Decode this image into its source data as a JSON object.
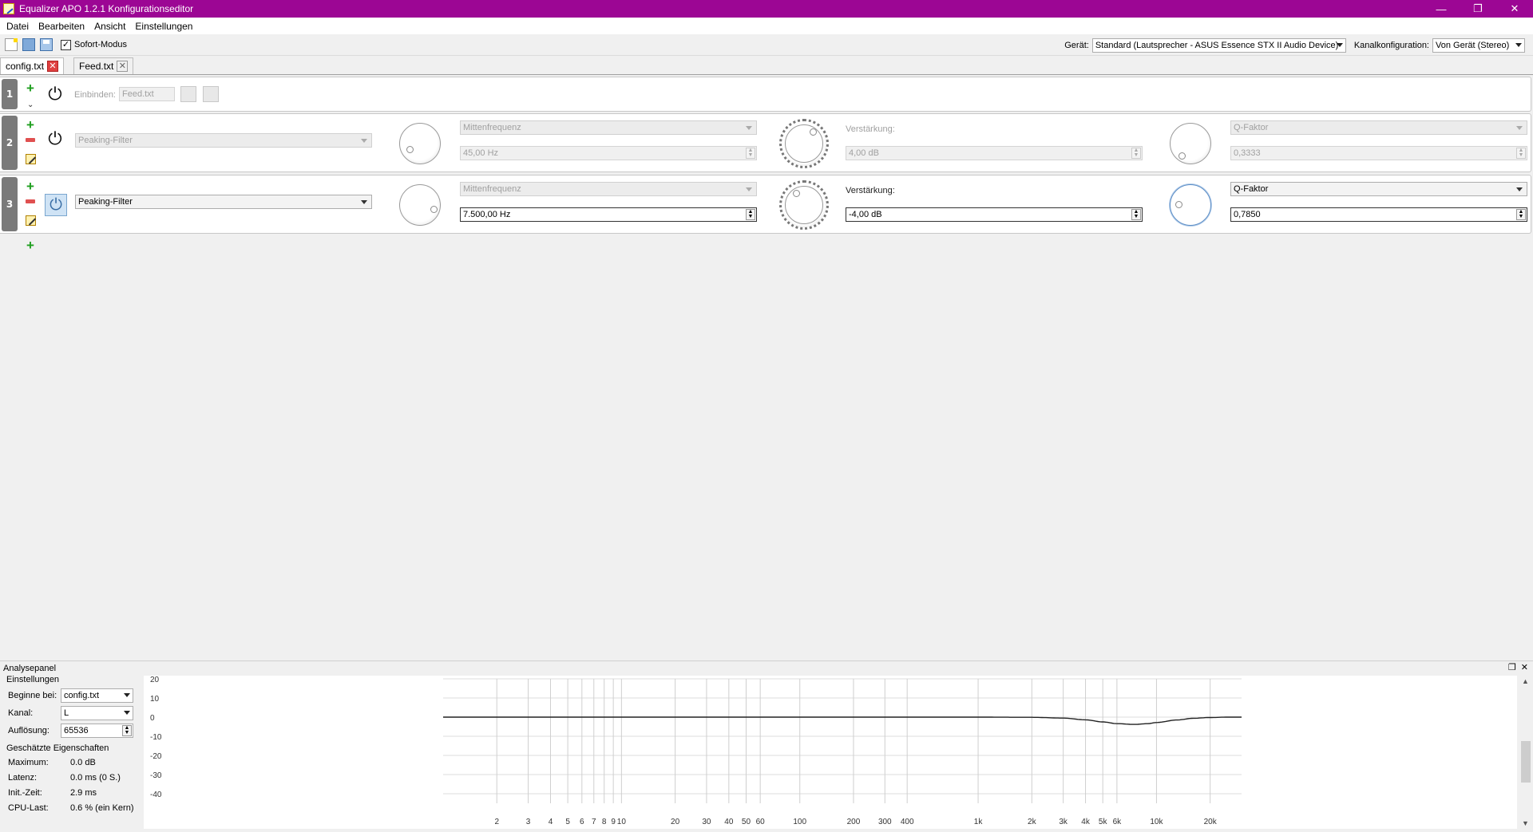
{
  "window": {
    "title": "Equalizer APO 1.2.1 Konfigurationseditor",
    "minimize_glyph": "—",
    "restore_glyph": "❐",
    "close_glyph": "✕",
    "titlebar_color": "#9c0694"
  },
  "menu": [
    "Datei",
    "Bearbeiten",
    "Ansicht",
    "Einstellungen"
  ],
  "toolbar": {
    "instant_mode_label": "Sofort-Modus",
    "instant_mode_checked": "✓",
    "device_label": "Gerät:",
    "device_value": "Standard (Lautsprecher - ASUS Essence STX II Audio Device)",
    "channel_config_label": "Kanalkonfiguration:",
    "channel_config_value": "Von Gerät (Stereo)"
  },
  "tabs": [
    {
      "label": "config.txt",
      "active": true
    },
    {
      "label": "Feed.txt",
      "active": false
    }
  ],
  "tab_close_glyph": "✕",
  "rows": [
    {
      "number": "1",
      "include_label": "Einbinden:",
      "include_value": "Feed.txt",
      "expand_glyph": "⌄"
    },
    {
      "number": "2",
      "filter_type": "Peaking-Filter",
      "freq_mode": "Mittenfrequenz",
      "freq_value": "45,00 Hz",
      "gain_label": "Verstärkung:",
      "gain_value": "4,00 dB",
      "q_mode": "Q-Faktor",
      "q_value": "0,3333"
    },
    {
      "number": "3",
      "filter_type": "Peaking-Filter",
      "freq_mode": "Mittenfrequenz",
      "freq_value": "7.500,00 Hz",
      "gain_label": "Verstärkung:",
      "gain_value": "-4,00 dB",
      "q_mode": "Q-Faktor",
      "q_value": "0,7850"
    }
  ],
  "glyphs": {
    "plus": "+",
    "power": "⏻",
    "spin": "▲\n▼"
  },
  "analysis": {
    "title": "Analysepanel",
    "float_glyph": "❐",
    "close_glyph": "✕",
    "settings_title": "Einstellungen",
    "start_label": "Beginne bei:",
    "start_value": "config.txt",
    "channel_label": "Kanal:",
    "channel_value": "L",
    "resolution_label": "Auflösung:",
    "resolution_value": "65536",
    "props_title": "Geschätzte Eigenschaften",
    "props": [
      {
        "label": "Maximum:",
        "value": "0.0 dB"
      },
      {
        "label": "Latenz:",
        "value": "0.0 ms (0 S.)"
      },
      {
        "label": "Init.-Zeit:",
        "value": "2.9 ms"
      },
      {
        "label": "CPU-Last:",
        "value": "0.6 % (ein Kern)"
      }
    ],
    "scroll_up": "▲",
    "scroll_down": "▼"
  },
  "chart_data": {
    "type": "line",
    "xscale": "log",
    "xlim": [
      1,
      30000
    ],
    "ylim": [
      -45,
      20
    ],
    "y_ticks": [
      "20",
      "10",
      "0",
      "-10",
      "-20",
      "-30",
      "-40"
    ],
    "y_tick_values": [
      20,
      10,
      0,
      -10,
      -20,
      -30,
      -40
    ],
    "x_tick_labels": [
      "2",
      "3",
      "4",
      "5",
      "6",
      "7",
      "8",
      "9",
      "10",
      "20",
      "30",
      "40",
      "50",
      "60",
      "100",
      "200",
      "300",
      "400",
      "1k",
      "2k",
      "3k",
      "4k",
      "5k",
      "6k",
      "10k",
      "20k"
    ],
    "x_tick_values": [
      2,
      3,
      4,
      5,
      6,
      7,
      8,
      9,
      10,
      20,
      30,
      40,
      50,
      60,
      100,
      200,
      300,
      400,
      1000,
      2000,
      3000,
      4000,
      5000,
      6000,
      10000,
      20000
    ],
    "series": [
      {
        "x": [
          1,
          10,
          100,
          1000,
          2000,
          3000,
          4000,
          5000,
          6000,
          7500,
          9000,
          10000,
          13000,
          16000,
          20000,
          25000,
          30000
        ],
        "y": [
          0,
          0,
          0,
          0,
          -0.1,
          -0.5,
          -1.4,
          -2.5,
          -3.4,
          -3.8,
          -3.4,
          -2.8,
          -1.5,
          -0.6,
          -0.2,
          0,
          0
        ]
      }
    ],
    "grid": true,
    "line_color": "#222222"
  }
}
